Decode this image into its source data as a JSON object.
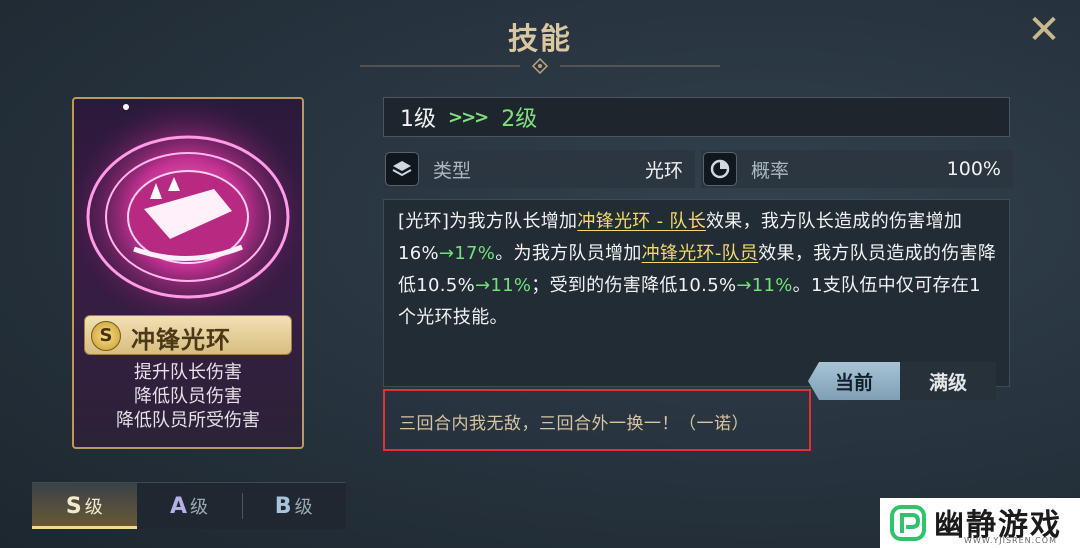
{
  "header": {
    "title": "技能",
    "close_icon": "close-icon"
  },
  "card": {
    "rank_badge": "S",
    "name": "冲锋光环",
    "effects": [
      "提升队长伤害",
      "降低队员伤害",
      "降低队员所受伤害"
    ],
    "art": "magic-circle-horn-icon"
  },
  "tabs": [
    {
      "letter": "S",
      "suffix": "级",
      "active": true
    },
    {
      "letter": "A",
      "suffix": "级",
      "active": false
    },
    {
      "letter": "B",
      "suffix": "级",
      "active": false
    }
  ],
  "level": {
    "current": "1级",
    "arrows": ">>>",
    "next": "2级"
  },
  "stats": {
    "type": {
      "icon": "layers-icon",
      "label": "类型",
      "value": "光环"
    },
    "rate": {
      "icon": "pie-chart-icon",
      "label": "概率",
      "value": "100%"
    }
  },
  "description": {
    "p1": "[光环]为我方队长增加",
    "link1": "冲锋光环 - 队长",
    "p2": "效果，我方队长造成的伤害增加16%",
    "up1": "→17%",
    "p3": "。为我方队员增加",
    "link2": "冲锋光环-队员",
    "p4": "效果，我方队员造成的伤害降低10.5%",
    "up2": "→11%",
    "p5": "；受到的伤害降低10.5%",
    "up3": "→11%",
    "p6": "。1支队伍中仅可存在1个光环技能。"
  },
  "toggle": {
    "current": "当前",
    "max": "满级"
  },
  "quote": "三回合内我无敌，三回合外一换一！（一诺）",
  "watermark": {
    "name": "幽静游戏",
    "url": "WWW.YJISREN.COM"
  },
  "colors": {
    "accent_gold": "#d9c7a1",
    "green_up": "#71e27a",
    "highlight_link": "#f5d86b",
    "red_box": "#e0303a"
  }
}
